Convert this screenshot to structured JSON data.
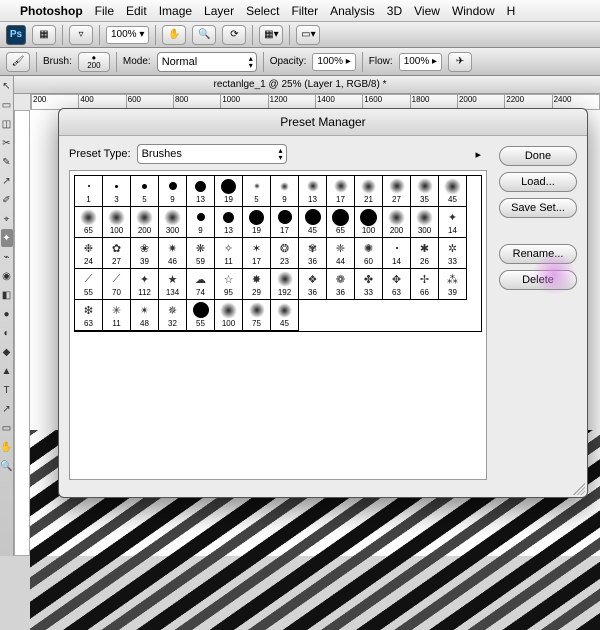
{
  "menubar": {
    "items": [
      "Photoshop",
      "File",
      "Edit",
      "Image",
      "Layer",
      "Select",
      "Filter",
      "Analysis",
      "3D",
      "View",
      "Window",
      "H"
    ]
  },
  "appbar": {
    "logo": "Ps",
    "zoom": "100%"
  },
  "options": {
    "brush_label": "Brush:",
    "brush_size": "200",
    "mode_label": "Mode:",
    "mode_value": "Normal",
    "opacity_label": "Opacity:",
    "opacity_value": "100%",
    "flow_label": "Flow:",
    "flow_value": "100%"
  },
  "document": {
    "title": "rectanlge_1 @ 25% (Layer 1, RGB/8) *",
    "ruler_ticks": [
      "200",
      "400",
      "600",
      "800",
      "1000",
      "1200",
      "1400",
      "1600",
      "1800",
      "2000",
      "2200",
      "2400"
    ]
  },
  "dialog": {
    "title": "Preset Manager",
    "preset_type_label": "Preset Type:",
    "preset_type_value": "Brushes",
    "buttons": {
      "done": "Done",
      "load": "Load...",
      "save": "Save Set...",
      "rename": "Rename...",
      "delete": "Delete"
    },
    "brushes": [
      {
        "n": "1",
        "t": "dot",
        "s": 2
      },
      {
        "n": "3",
        "t": "dot",
        "s": 3
      },
      {
        "n": "5",
        "t": "dot",
        "s": 5
      },
      {
        "n": "9",
        "t": "dot",
        "s": 8
      },
      {
        "n": "13",
        "t": "dot",
        "s": 11
      },
      {
        "n": "19",
        "t": "dot",
        "s": 15
      },
      {
        "n": "5",
        "t": "soft",
        "s": 6
      },
      {
        "n": "9",
        "t": "soft",
        "s": 9
      },
      {
        "n": "13",
        "t": "soft",
        "s": 12
      },
      {
        "n": "17",
        "t": "soft",
        "s": 14
      },
      {
        "n": "21",
        "t": "soft",
        "s": 15
      },
      {
        "n": "27",
        "t": "soft",
        "s": 16
      },
      {
        "n": "35",
        "t": "soft",
        "s": 16
      },
      {
        "n": "45",
        "t": "soft",
        "s": 17
      },
      {
        "n": "65",
        "t": "soft",
        "s": 17
      },
      {
        "n": "100",
        "t": "soft",
        "s": 17
      },
      {
        "n": "200",
        "t": "soft",
        "s": 17
      },
      {
        "n": "300",
        "t": "soft",
        "s": 17
      },
      {
        "n": "9",
        "t": "dot",
        "s": 8
      },
      {
        "n": "13",
        "t": "dot",
        "s": 11
      },
      {
        "n": "19",
        "t": "dot",
        "s": 15
      },
      {
        "n": "17",
        "t": "dot",
        "s": 14
      },
      {
        "n": "45",
        "t": "dot",
        "s": 16
      },
      {
        "n": "65",
        "t": "dot",
        "s": 17
      },
      {
        "n": "100",
        "t": "dot",
        "s": 17
      },
      {
        "n": "200",
        "t": "soft",
        "s": 17
      },
      {
        "n": "300",
        "t": "soft",
        "s": 17
      },
      {
        "n": "14",
        "t": "tex",
        "g": "✦"
      },
      {
        "n": "24",
        "t": "tex",
        "g": "❉"
      },
      {
        "n": "27",
        "t": "tex",
        "g": "✿"
      },
      {
        "n": "39",
        "t": "tex",
        "g": "❀"
      },
      {
        "n": "46",
        "t": "tex",
        "g": "✷"
      },
      {
        "n": "59",
        "t": "tex",
        "g": "❋"
      },
      {
        "n": "11",
        "t": "tex",
        "g": "✧"
      },
      {
        "n": "17",
        "t": "tex",
        "g": "✶"
      },
      {
        "n": "23",
        "t": "tex",
        "g": "❂"
      },
      {
        "n": "36",
        "t": "tex",
        "g": "✾"
      },
      {
        "n": "44",
        "t": "tex",
        "g": "❈"
      },
      {
        "n": "60",
        "t": "tex",
        "g": "✺"
      },
      {
        "n": "14",
        "t": "dot",
        "s": 2
      },
      {
        "n": "26",
        "t": "tex",
        "g": "✱"
      },
      {
        "n": "33",
        "t": "tex",
        "g": "✲"
      },
      {
        "n": "55",
        "t": "tex",
        "g": "⟋"
      },
      {
        "n": "70",
        "t": "tex",
        "g": "⟋"
      },
      {
        "n": "112",
        "t": "tex",
        "g": "✦"
      },
      {
        "n": "134",
        "t": "tex",
        "g": "★"
      },
      {
        "n": "74",
        "t": "tex",
        "g": "☁"
      },
      {
        "n": "95",
        "t": "tex",
        "g": "☆"
      },
      {
        "n": "29",
        "t": "tex",
        "g": "✸"
      },
      {
        "n": "192",
        "t": "soft",
        "s": 16
      },
      {
        "n": "36",
        "t": "tex",
        "g": "❖"
      },
      {
        "n": "36",
        "t": "tex",
        "g": "❁"
      },
      {
        "n": "33",
        "t": "tex",
        "g": "✤"
      },
      {
        "n": "63",
        "t": "tex",
        "g": "✥"
      },
      {
        "n": "66",
        "t": "tex",
        "g": "✢"
      },
      {
        "n": "39",
        "t": "tex",
        "g": "⁂"
      },
      {
        "n": "63",
        "t": "tex",
        "g": "❇"
      },
      {
        "n": "11",
        "t": "tex",
        "g": "✳"
      },
      {
        "n": "48",
        "t": "tex",
        "g": "✴"
      },
      {
        "n": "32",
        "t": "tex",
        "g": "✵"
      },
      {
        "n": "55",
        "t": "dot",
        "s": 16
      },
      {
        "n": "100",
        "t": "soft",
        "s": 17
      },
      {
        "n": "75",
        "t": "soft",
        "s": 16
      },
      {
        "n": "45",
        "t": "soft",
        "s": 15
      }
    ]
  },
  "toolbox": {
    "tools": [
      "↖",
      "▭",
      "◫",
      "✂",
      "✎",
      "↗",
      "✐",
      "⌖",
      "✦",
      "⌁",
      "◉",
      "◧",
      "●",
      "◐",
      "◆",
      "▲",
      "T",
      "↗",
      "▭",
      "✋",
      "🔍"
    ]
  }
}
